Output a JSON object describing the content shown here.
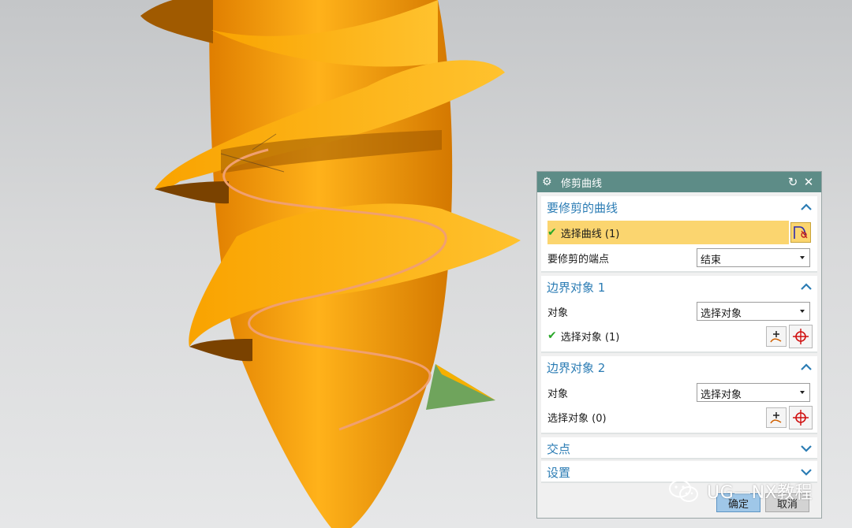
{
  "dialog": {
    "title": "修剪曲线",
    "groups": [
      {
        "title": "要修剪的曲线",
        "expanded": true,
        "rows": [
          {
            "label": "选择曲线 (1)",
            "checked": true,
            "highlighted": true
          },
          {
            "label": "要修剪的端点",
            "combo_value": "结束"
          }
        ]
      },
      {
        "title": "边界对象 1",
        "expanded": true,
        "rows": [
          {
            "label": "对象",
            "combo_value": "选择对象"
          },
          {
            "label": "选择对象 (1)",
            "checked": true
          }
        ]
      },
      {
        "title": "边界对象 2",
        "expanded": true,
        "rows": [
          {
            "label": "对象",
            "combo_value": "选择对象"
          },
          {
            "label": "选择对象 (0)",
            "checked": false
          }
        ]
      },
      {
        "title": "交点",
        "expanded": false
      },
      {
        "title": "设置",
        "expanded": false
      }
    ],
    "footer": {
      "ok": "确定",
      "cancel": "取消"
    }
  },
  "watermark": {
    "text": "UG—NX教程"
  },
  "colors": {
    "titlebar": "#5d8c87",
    "group_title": "#2b7cb4",
    "selection_highlight": "#fbd56f",
    "model_orange": "#f5a000",
    "model_helix": "#f0a070",
    "plane_green": "#6fa45c"
  }
}
